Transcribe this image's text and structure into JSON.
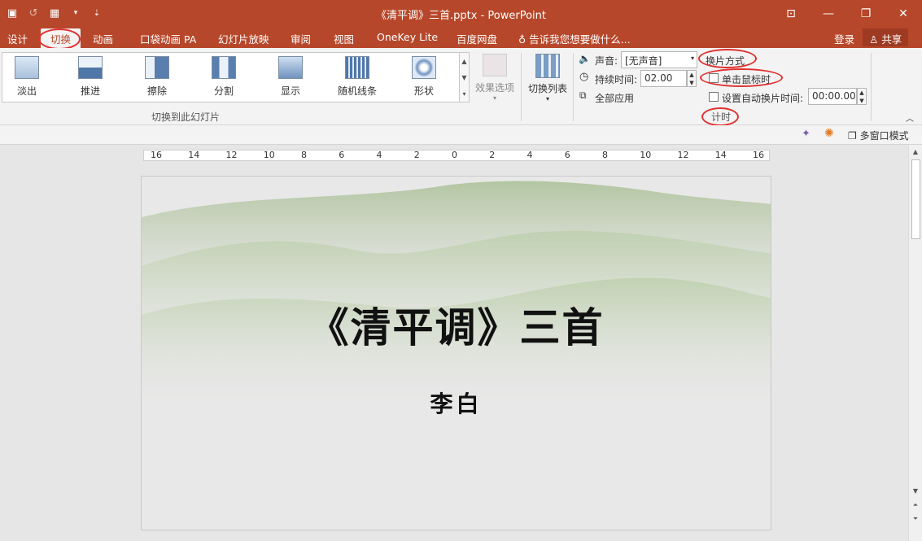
{
  "window": {
    "title": "《清平调》三首.pptx - PowerPoint",
    "qat_icons": [
      "save-icon",
      "undo-icon",
      "layout-icon",
      "dropdown-icon",
      "customize-icon"
    ],
    "controls": {
      "restore_ribbon": "⊡",
      "minimize": "—",
      "maximize": "❐",
      "close": "✕"
    }
  },
  "tabs": [
    {
      "label": "设计"
    },
    {
      "label": "切换",
      "active": true
    },
    {
      "label": "动画"
    },
    {
      "label": "口袋动画 PA"
    },
    {
      "label": "幻灯片放映"
    },
    {
      "label": "审阅"
    },
    {
      "label": "视图"
    },
    {
      "label": "OneKey Lite"
    },
    {
      "label": "百度网盘"
    }
  ],
  "tell_me": "告诉我您想要做什么...",
  "account": {
    "login": "登录",
    "share": "共享"
  },
  "ribbon": {
    "transitions": [
      "淡出",
      "推进",
      "擦除",
      "分割",
      "显示",
      "随机线条",
      "形状"
    ],
    "group_label": "切换到此幻灯片",
    "effect_options": "效果选项",
    "switch_list": "切换列表",
    "sound_label": "声音:",
    "sound_value": "[无声音]",
    "duration_label": "持续时间:",
    "duration_value": "02.00",
    "apply_all": "全部应用",
    "advance_label": "换片方式",
    "on_click_label": "单击鼠标时",
    "after_label": "设置自动换片时间:",
    "after_value": "00:00.00",
    "timing_label": "计时"
  },
  "cmdbar": {
    "multi_window": "多窗口模式"
  },
  "ruler": {
    "labels": [
      "16",
      "14",
      "12",
      "10",
      "8",
      "6",
      "4",
      "2",
      "0",
      "2",
      "4",
      "6",
      "8",
      "10",
      "12",
      "14",
      "16"
    ]
  },
  "slide": {
    "title": "《清平调》三首",
    "subtitle": "李白"
  },
  "colors": {
    "accent": "#b7472a",
    "annotation": "#e03030"
  }
}
